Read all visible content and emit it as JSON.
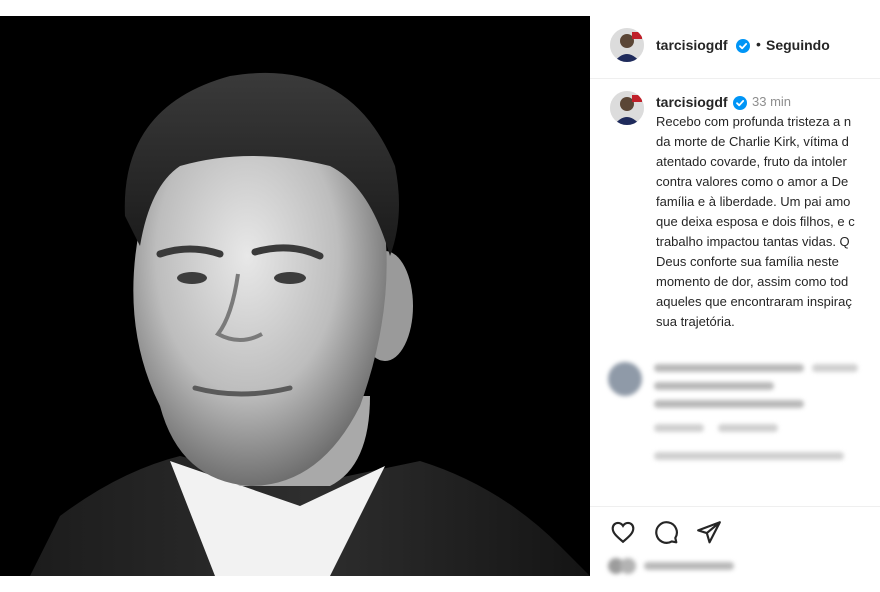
{
  "header": {
    "username": "tarcisiogdf",
    "separator": "•",
    "follow_label": "Seguindo"
  },
  "post": {
    "username": "tarcisiogdf",
    "time": "33 min",
    "caption": "Recebo com profunda tristeza a n\nda morte de Charlie Kirk, vítima d\natentado covarde, fruto da intoler\ncontra valores como o amor a De\nfamília e à liberdade. Um pai amo\nque deixa esposa e dois filhos, e c\ntrabalho impactou tantas vidas. Q\nDeus conforte sua família neste\nmomento de dor, assim como tod\naqueles que encontraram inspiraç\nsua trajetória."
  },
  "icons": {
    "verified": "verified-badge-icon",
    "like": "heart-icon",
    "comment": "comment-icon",
    "share": "send-icon"
  },
  "colors": {
    "verified": "#0095f6",
    "text": "#262626",
    "muted": "#8e8e8e",
    "border": "#efefef"
  }
}
